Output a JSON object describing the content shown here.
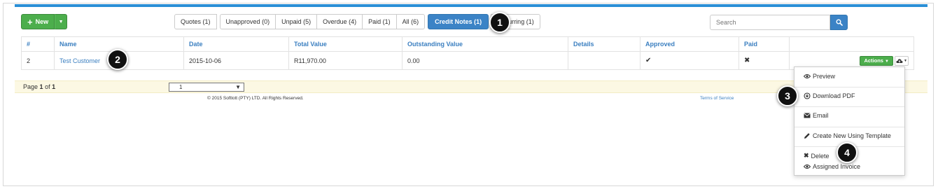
{
  "toolbar": {
    "new_label": "New"
  },
  "filters": [
    {
      "label": "Quotes (1)"
    },
    {
      "label": "Unapproved (0)"
    },
    {
      "label": "Unpaid (5)"
    },
    {
      "label": "Overdue (4)"
    },
    {
      "label": "Paid (1)"
    },
    {
      "label": "All (6)"
    },
    {
      "label": "Credit Notes (1)"
    },
    {
      "label": "urring (1)"
    }
  ],
  "search": {
    "placeholder": "Search"
  },
  "table": {
    "columns": [
      "#",
      "Name",
      "Date",
      "Total Value",
      "Outstanding Value",
      "Details",
      "Approved",
      "Paid",
      ""
    ],
    "rows": [
      {
        "number": "2",
        "name": "Test Customer",
        "date": "2015-10-06",
        "total_value": "R11,970.00",
        "outstanding_value": "0.00",
        "details": "",
        "approved": "✔",
        "paid": "✖",
        "actions_label": "Actions"
      }
    ]
  },
  "pager": {
    "page_prefix": "Page",
    "page_current": "1",
    "page_of": "of",
    "page_total": "1",
    "select_value": "1"
  },
  "footer": {
    "copyright": "© 2015 Softlott (PTY) LTD. All Rights Reserved.",
    "terms": "Terms of Service"
  },
  "actions_menu": {
    "items": [
      {
        "label": "Preview",
        "icon": "eye-icon"
      },
      {
        "label": "Download PDF",
        "icon": "download-icon"
      },
      {
        "label": "Email",
        "icon": "envelope-icon"
      },
      {
        "label": "Create New Using Template",
        "icon": "pencil-icon"
      },
      {
        "label": "Delete",
        "icon": "x-icon"
      },
      {
        "label": "Assigned Invoice",
        "icon": "eye-icon"
      }
    ]
  },
  "callouts": [
    "1",
    "2",
    "3",
    "4"
  ],
  "colors": {
    "accent_blue": "#3b83c6",
    "top_bar": "#2a8fd6",
    "success_green": "#4cae4c",
    "link_blue": "#3b7fc0",
    "pager_bg": "#fcf8e3"
  }
}
